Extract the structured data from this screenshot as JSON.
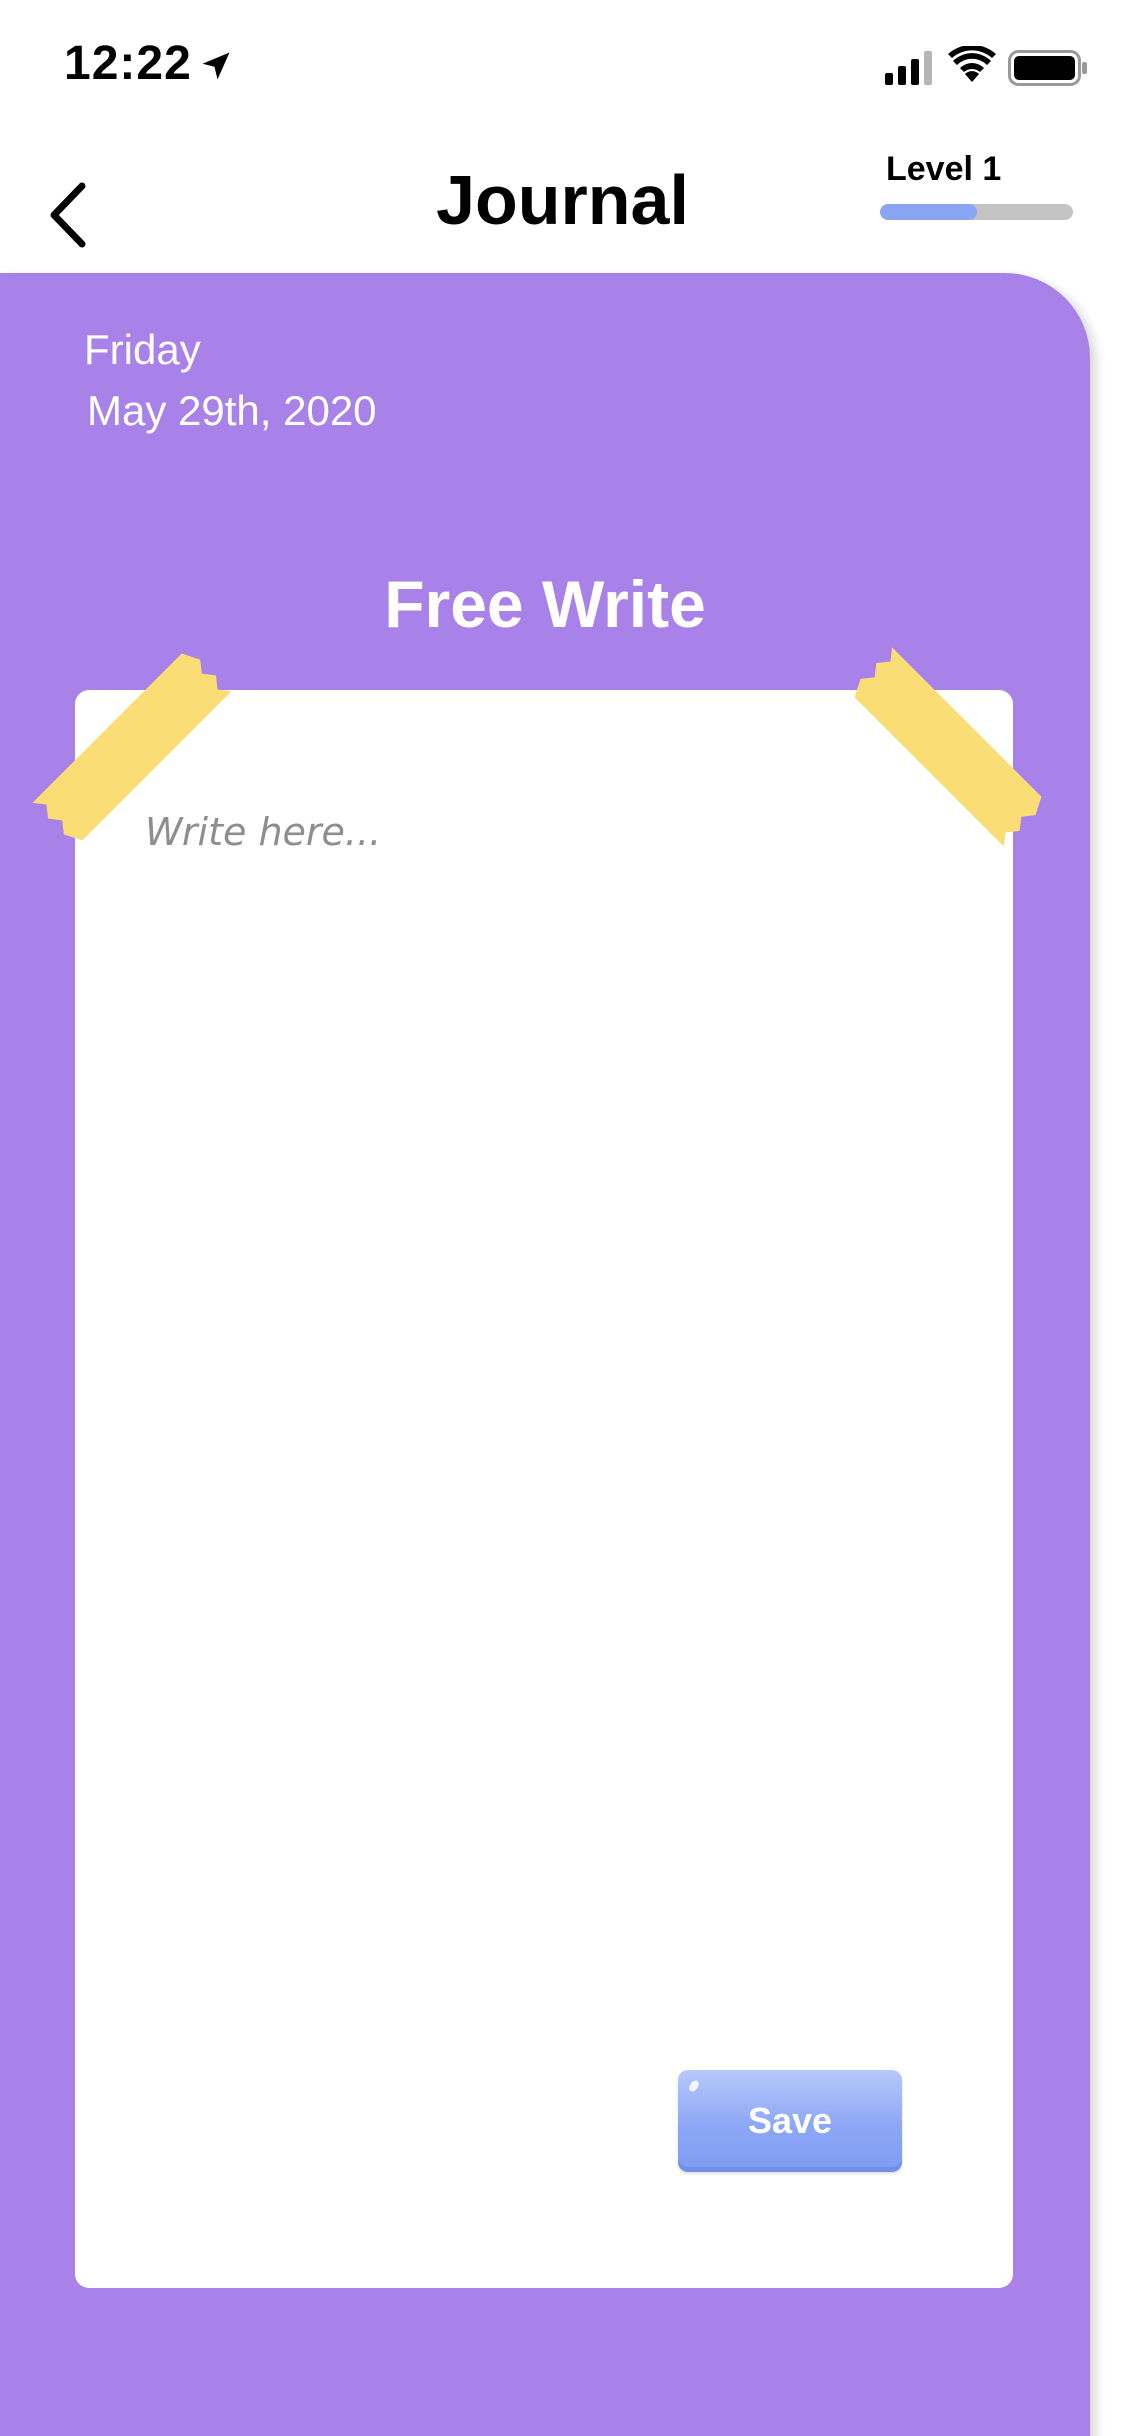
{
  "status_bar": {
    "time": "12:22"
  },
  "header": {
    "title": "Journal",
    "level_label": "Level 1",
    "level_progress": 0.5
  },
  "entry": {
    "day": "Friday",
    "date": "May 29th, 2020",
    "section_title": "Free Write",
    "placeholder": "Write here...",
    "save_label": "Save"
  },
  "colors": {
    "panel": "#a882e8",
    "tape": "#fbdd76",
    "accent": "#8aa5f3",
    "track": "#c4c4c4"
  },
  "icons": [
    "location-arrow-icon",
    "signal-icon",
    "wifi-icon",
    "battery-icon",
    "back-chevron-icon"
  ]
}
